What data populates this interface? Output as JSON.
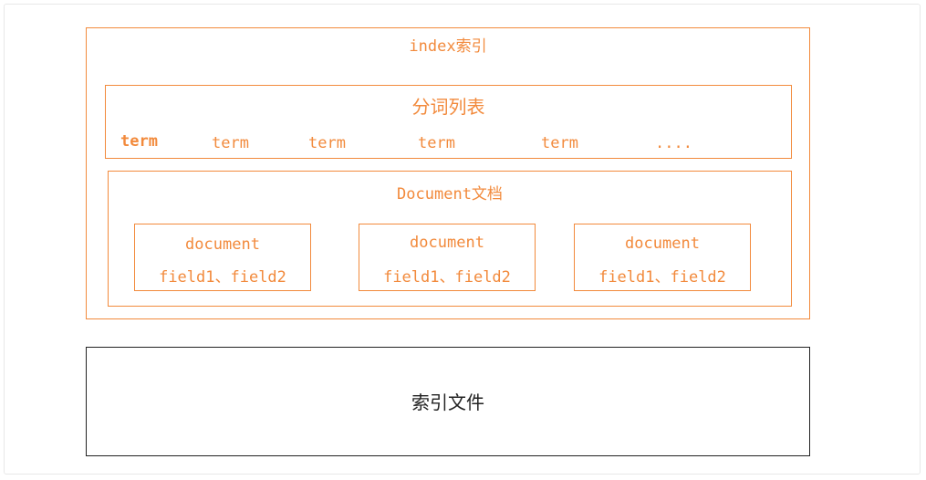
{
  "colors": {
    "accent": "#f28a3c",
    "outline": "#222222"
  },
  "index": {
    "title": "index索引"
  },
  "terms": {
    "title": "分词列表",
    "items": [
      "term",
      "term",
      "term",
      "term",
      "term",
      "...."
    ]
  },
  "documents": {
    "title": "Document文档",
    "items": [
      {
        "name": "document",
        "fields": "field1、field2"
      },
      {
        "name": "document",
        "fields": "field1、field2"
      },
      {
        "name": "document",
        "fields": "field1、field2"
      }
    ]
  },
  "file": {
    "title": "索引文件"
  }
}
